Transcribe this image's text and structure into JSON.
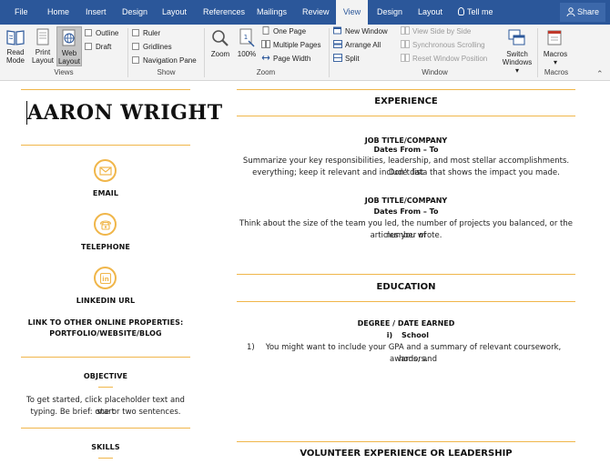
{
  "tabs": [
    "File",
    "Home",
    "Insert",
    "Design",
    "Layout",
    "References",
    "Mailings",
    "Review",
    "View",
    "Design",
    "Layout"
  ],
  "active_tab": "View",
  "tell_me": "Tell me",
  "share": "Share",
  "ribbon": {
    "views": {
      "label": "Views",
      "read_mode": [
        "Read",
        "Mode"
      ],
      "print_layout": [
        "Print",
        "Layout"
      ],
      "web_layout": [
        "Web",
        "Layout"
      ],
      "outline": "Outline",
      "draft": "Draft"
    },
    "show": {
      "label": "Show",
      "ruler": "Ruler",
      "gridlines": "Gridlines",
      "navigation_pane": "Navigation Pane"
    },
    "zoom": {
      "label": "Zoom",
      "zoom": "Zoom",
      "hundred": "100%",
      "one_page": "One Page",
      "multiple_pages": "Multiple Pages",
      "page_width": "Page Width"
    },
    "window": {
      "label": "Window",
      "new_window": "New Window",
      "arrange_all": "Arrange All",
      "split": "Split",
      "view_side_by_side": "View Side by Side",
      "synchronous_scrolling": "Synchronous Scrolling",
      "reset_window_position": "Reset Window Position",
      "switch_windows": [
        "Switch",
        "Windows ▾"
      ]
    },
    "macros": {
      "label": "Macros",
      "macros": [
        "Macros",
        "▾"
      ]
    }
  },
  "resume": {
    "name": "AARON WRIGHT",
    "contacts": [
      {
        "label": "EMAIL",
        "icon": "envelope-icon"
      },
      {
        "label": "TELEPHONE",
        "icon": "phone-icon"
      },
      {
        "label": "LINKEDIN URL",
        "icon": "linkedin-icon"
      }
    ],
    "other_links": [
      "LINK TO OTHER ONLINE PROPERTIES:",
      "PORTFOLIO/WEBSITE/BLOG"
    ],
    "objective": {
      "heading": "OBJECTIVE",
      "text": [
        "To get started, click placeholder text and start",
        "typing. Be brief: one or two sentences."
      ]
    },
    "skills_heading": "SKILLS",
    "experience": {
      "heading": "EXPERIENCE",
      "jobs": [
        {
          "title": "JOB TITLE/COMPANY",
          "dates": "Dates From – To",
          "text": [
            "Summarize your key responsibilities, leadership, and most stellar accomplishments. Don’t list",
            "everything; keep it relevant and include data that shows the impact you made."
          ]
        },
        {
          "title": "JOB TITLE/COMPANY",
          "dates": "Dates From – To",
          "text": [
            "Think about the size of the team you led, the number of projects you balanced, or the number of",
            "articles you wrote."
          ]
        }
      ]
    },
    "education": {
      "heading": "EDUCATION",
      "degree": "DEGREE / DATE EARNED",
      "school_marker": "i)",
      "school": "School",
      "item_marker": "1)",
      "text": [
        "You might want to include your GPA and a summary of relevant coursework, awards, and",
        "honors."
      ]
    },
    "volunteer_heading": "VOLUNTEER EXPERIENCE OR LEADERSHIP"
  },
  "colors": {
    "ribbon_blue": "#2b579a",
    "accent_gold": "#f0b64a"
  }
}
